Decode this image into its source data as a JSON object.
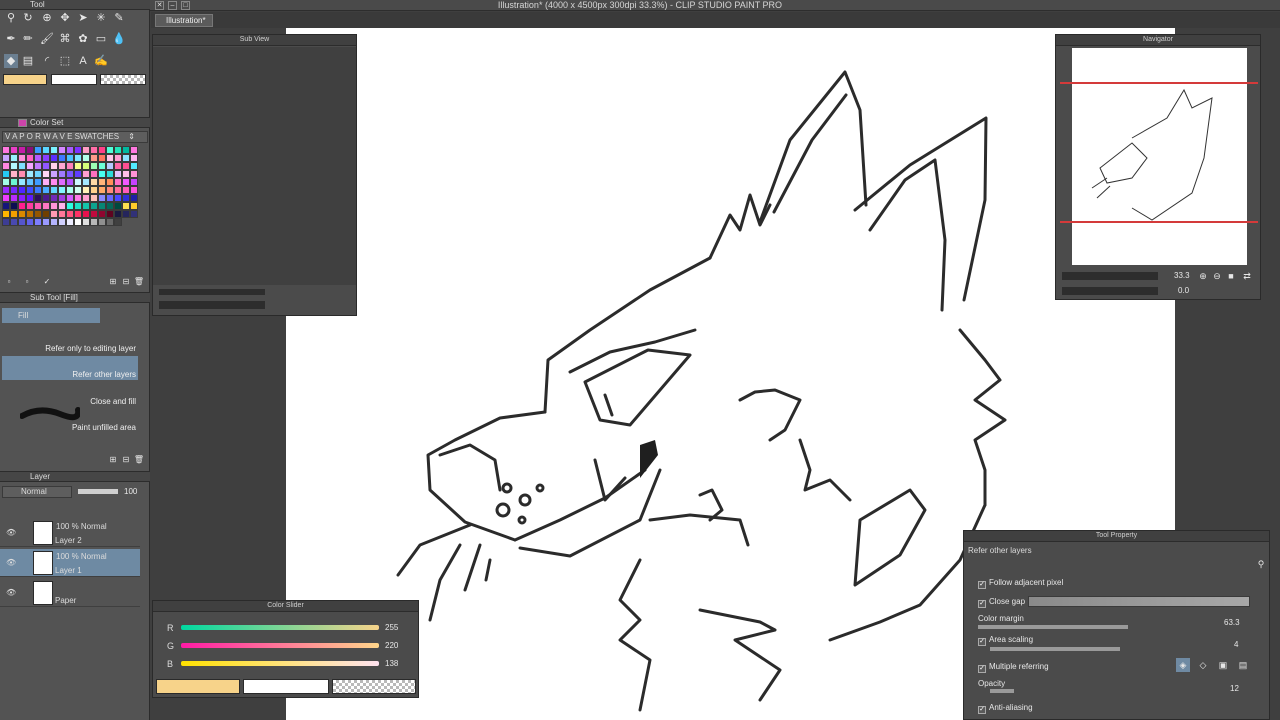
{
  "window": {
    "title": "Illustration* (4000 x 4500px 300dpi 33.3%)  - CLIP STUDIO PAINT PRO",
    "doc_tab": "Illustration*"
  },
  "tool_panel": {
    "title": "Tool",
    "main_color": "#f7d38a",
    "sub_color": "#ffffff"
  },
  "color_set": {
    "title": "Color Set",
    "set_name": "V A P O R W A V E SWATCHES",
    "swatches": [
      "#ff77e0",
      "#e83fc6",
      "#c51ea7",
      "#8a0e7a",
      "#3a9cff",
      "#5ad6ff",
      "#7bf2ff",
      "#d486ff",
      "#a95bff",
      "#7d32ff",
      "#ff9ec5",
      "#ff6ea8",
      "#ff3f88",
      "#51ffd9",
      "#22e4b9",
      "#00b8a0",
      "#ff77e0",
      "#c7a4ff",
      "#98f0ff",
      "#ff8ed9",
      "#ff5fc2",
      "#b55bff",
      "#8a3dff",
      "#5b2eff",
      "#3f78ff",
      "#4ac1ff",
      "#7ee8ff",
      "#b3ffe8",
      "#ff9a8a",
      "#ff7560",
      "#ffc6e9",
      "#ff9ed4",
      "#8ce1ff",
      "#ffb4f0",
      "#ff87e2",
      "#b2f7ff",
      "#7fe0ff",
      "#f5a6ff",
      "#c17aff",
      "#9157ff",
      "#ffd1e8",
      "#ffa8d2",
      "#ff80bc",
      "#f3ff8a",
      "#d2ff7a",
      "#9bffb5",
      "#6dffd8",
      "#b5c9ff",
      "#ff66a8",
      "#ff4f92",
      "#52e9ff",
      "#26c9f5",
      "#ffb3c9",
      "#ff8cb0",
      "#9ee8ff",
      "#70d4ff",
      "#ffd5f5",
      "#c9a3ff",
      "#a07bff",
      "#7a56ff",
      "#5f3dff",
      "#ff9fd1",
      "#ff6fbd",
      "#49ffef",
      "#2bdcd9",
      "#e4c3ff",
      "#ffbfe9",
      "#ff92d6",
      "#a2ffe6",
      "#6bf7d4",
      "#93e8ff",
      "#63c4ff",
      "#3e9cff",
      "#ffb0f7",
      "#ff8af0",
      "#df6cff",
      "#b553ff",
      "#cef9ff",
      "#a4e9ff",
      "#ffd9a6",
      "#ffb57a",
      "#ff8f5a",
      "#ff71c8",
      "#f159ff",
      "#c642ff",
      "#9a2cff",
      "#732aff",
      "#4f26ff",
      "#3f4aff",
      "#3c7cff",
      "#4cadff",
      "#63d6ff",
      "#84f4ff",
      "#aaffee",
      "#cffff0",
      "#fff1b8",
      "#ffd28c",
      "#ffaa6a",
      "#ff8a7a",
      "#ff6d9a",
      "#ff5cbc",
      "#ff4fe0",
      "#ee3dff",
      "#b92dff",
      "#8a1fff",
      "#611bff",
      "#2c0f5c",
      "#4d1a8c",
      "#7229b8",
      "#9f3ee0",
      "#d45cff",
      "#ff7ae8",
      "#ffa0d0",
      "#ffc2b8",
      "#8a8aff",
      "#6969ff",
      "#4848ff",
      "#2f2fd6",
      "#1f1fa6",
      "#15157a",
      "#0d0d52",
      "#ff1f8f",
      "#ff3da0",
      "#ff5ab2",
      "#ff78c4",
      "#ff96d6",
      "#ffb4e8",
      "#2bffe0",
      "#1de0c5",
      "#14c2aa",
      "#0da48f",
      "#078674",
      "#036859",
      "#004a3f",
      "#ffe14f",
      "#ffcc2a",
      "#ffb700",
      "#f2a000",
      "#d98800",
      "#b96e00",
      "#945600",
      "#6f3f00",
      "#ff9bb3",
      "#ff7899",
      "#ff557f",
      "#ff3265",
      "#e8114d",
      "#c00a3e",
      "#8f0630",
      "#5e0320",
      "#1a1a40",
      "#25255c",
      "#313178",
      "#3d3d94",
      "#4949b0",
      "#5555cc",
      "#6161e8",
      "#7d7dff",
      "#9999ff",
      "#b5b5ff",
      "#d1d1ff",
      "#ededff",
      "#ffffff",
      "#e0e0e0",
      "#b8b8b8",
      "#909090",
      "#686868",
      "#404040"
    ]
  },
  "sub_tool": {
    "title": "Sub Tool [Fill]",
    "group": "Fill",
    "items": [
      {
        "label": "Refer only to editing layer"
      },
      {
        "label": "Refer other layers"
      },
      {
        "label": "Close and fill"
      },
      {
        "label": "Paint unfilled area"
      }
    ]
  },
  "layer_panel": {
    "title": "Layer",
    "blend_mode": "Normal",
    "opacity": "100",
    "layers": [
      {
        "info": "100 % Normal",
        "name": "Layer 2"
      },
      {
        "info": "100 % Normal",
        "name": "Layer 1"
      },
      {
        "info": "",
        "name": "Paper"
      }
    ]
  },
  "sub_view": {
    "title": "Sub View"
  },
  "navigator": {
    "title": "Navigator",
    "zoom": "33.3",
    "rotation": "0.0"
  },
  "color_slider": {
    "title": "Color Slider",
    "channels": [
      {
        "label": "R",
        "value": "255",
        "level": 1.0
      },
      {
        "label": "G",
        "value": "220",
        "level": 0.86
      },
      {
        "label": "B",
        "value": "138",
        "level": 0.54
      }
    ]
  },
  "tool_property": {
    "title": "Tool Property",
    "header": "Refer other layers",
    "follow_adjacent": "Follow adjacent pixel",
    "close_gap": "Close gap",
    "color_margin": "Color margin",
    "color_margin_value": "63.3",
    "area_scaling": "Area scaling",
    "area_scaling_value": "4",
    "multiple_referring": "Multiple referring",
    "opacity": "Opacity",
    "opacity_value": "12",
    "anti_aliasing": "Anti-aliasing"
  }
}
